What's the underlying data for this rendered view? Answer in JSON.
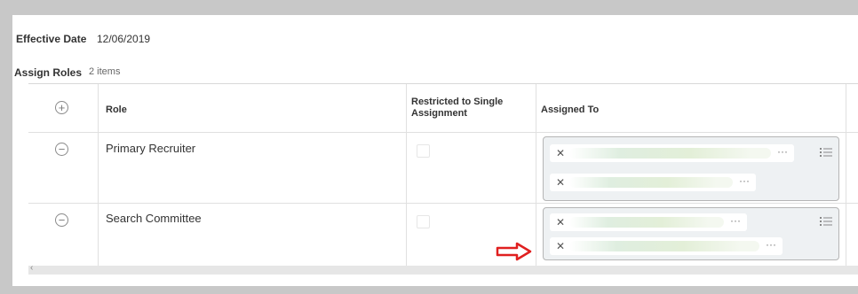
{
  "effective_date": {
    "label": "Effective Date",
    "value": "12/06/2019"
  },
  "assign_roles": {
    "title": "Assign Roles",
    "count": "2 items"
  },
  "table": {
    "headers": {
      "role": "Role",
      "restricted": "Restricted to Single Assignment",
      "assigned_to": "Assigned To"
    },
    "rows": [
      {
        "role": "Primary Recruiter"
      },
      {
        "role": "Search Committee"
      }
    ]
  },
  "icons": {
    "add": "plus-circle-icon",
    "remove": "minus-circle-icon",
    "remove_value": "x-icon",
    "more": "ellipsis-icon",
    "list": "list-icon",
    "annotation": "red-arrow-icon"
  },
  "colors": {
    "annotation_arrow": "#e02020",
    "background": "#c8c8c8"
  }
}
